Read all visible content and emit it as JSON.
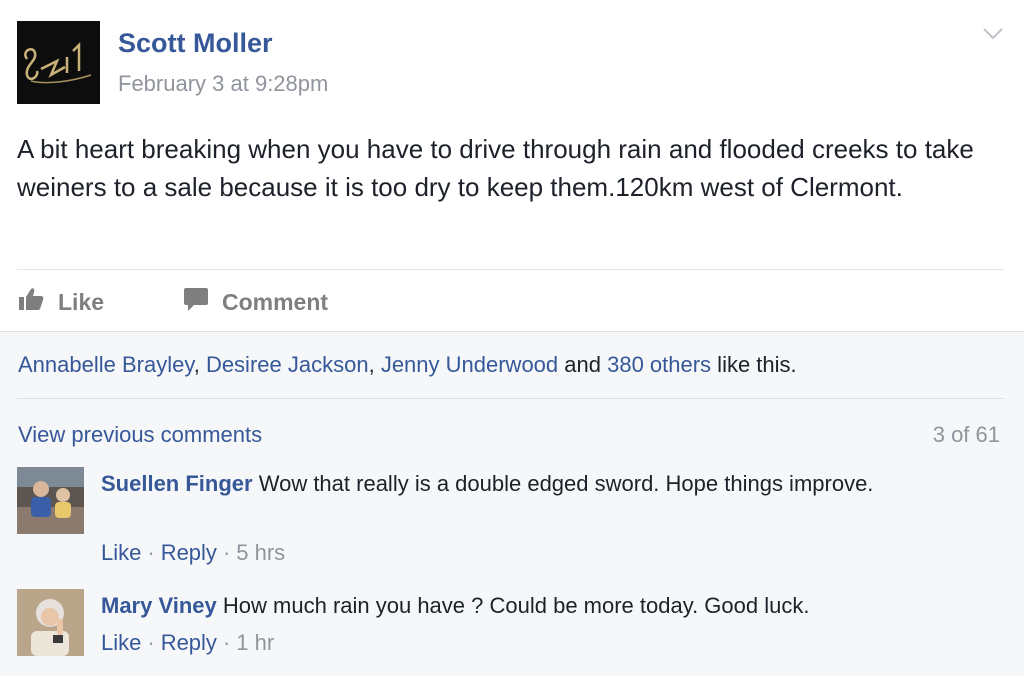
{
  "post": {
    "author": "Scott Moller",
    "timestamp": "February 3 at 9:28pm",
    "text": "A bit heart breaking when you have to drive through rain and flooded creeks to take weiners to a sale because it is too dry to keep them.120km west of Clermont.",
    "actions": {
      "like": "Like",
      "comment": "Comment"
    }
  },
  "likes": {
    "names": [
      "Annabelle Brayley",
      "Desiree Jackson",
      "Jenny Underwood"
    ],
    "sep1": ", ",
    "sep2": ", ",
    "and": " and ",
    "others": "380 others",
    "suffix": " like this."
  },
  "comments_header": {
    "view_previous": "View previous comments",
    "count": "3 of 61"
  },
  "comments": [
    {
      "name": "Suellen Finger",
      "text": "Wow that really is a double edged sword. Hope things improve.",
      "like": "Like",
      "reply": "Reply",
      "time": "5 hrs"
    },
    {
      "name": "Mary Viney",
      "text": "How much rain you have ? Could be more today. Good luck.",
      "like": "Like",
      "reply": "Reply",
      "time": "1 hr"
    }
  ],
  "colors": {
    "link": "#365899",
    "meta": "#90949c",
    "text": "#1d2129",
    "ufi_bg": "#f6f7f9"
  },
  "icons": {
    "post_menu": "chevron-down-icon",
    "like": "thumbs-up-icon",
    "comment": "comment-bubble-icon"
  }
}
